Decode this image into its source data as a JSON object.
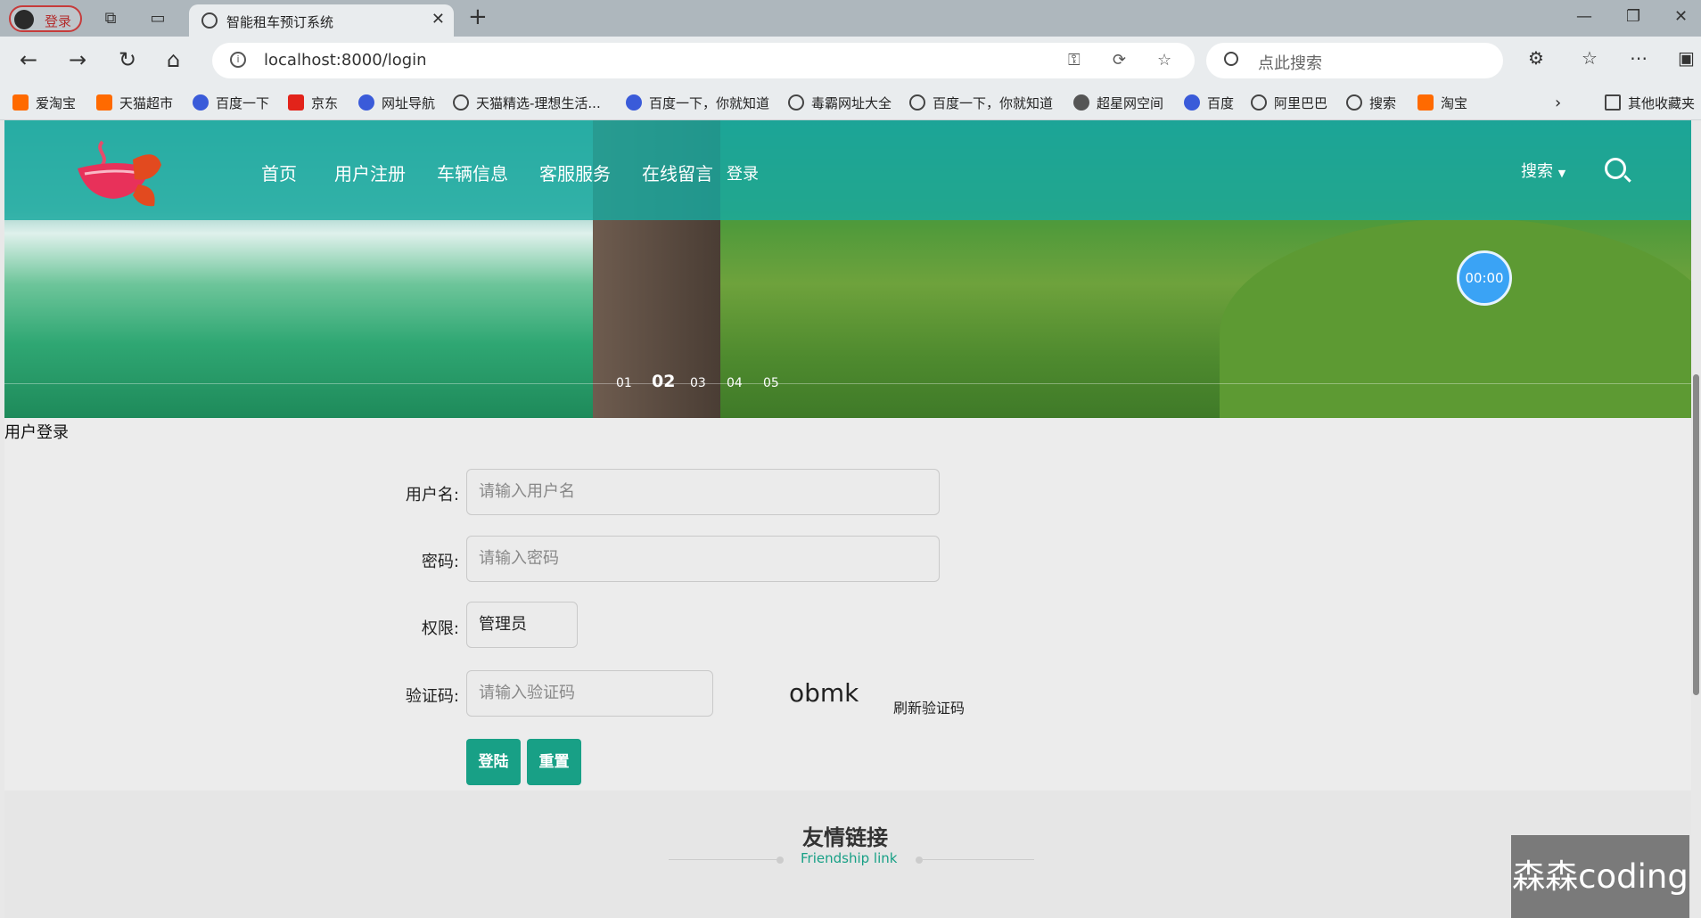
{
  "browser": {
    "profile_label": "登录",
    "tab_title": "智能租车预订系统",
    "url": "localhost:8000/login",
    "search_placeholder": "点此搜索",
    "bookmarks": [
      "爱淘宝",
      "天猫超市",
      "百度一下",
      "京东",
      "网址导航",
      "天猫精选-理想生活...",
      "百度一下，你就知道",
      "毒霸网址大全",
      "百度一下，你就知道",
      "超星网空间",
      "百度",
      "阿里巴巴",
      "搜索",
      "淘宝"
    ],
    "other_bookmarks": "其他收藏夹"
  },
  "site": {
    "nav": [
      "首页",
      "用户注册",
      "车辆信息",
      "客服服务",
      "在线留言",
      "登录"
    ],
    "search_label": "搜索",
    "timer": "00:00",
    "slides": [
      "01",
      "02",
      "03",
      "04",
      "05"
    ],
    "active_slide": "02"
  },
  "login": {
    "section_title": "用户登录",
    "username_label": "用户名:",
    "username_placeholder": "请输入用户名",
    "password_label": "密码:",
    "password_placeholder": "请输入密码",
    "role_label": "权限:",
    "role_value": "管理员",
    "captcha_label": "验证码:",
    "captcha_placeholder": "请输入验证码",
    "captcha_text": "obmk",
    "refresh_label": "刷新验证码",
    "login_button": "登陆",
    "reset_button": "重置"
  },
  "footer": {
    "title": "友情链接",
    "subtitle": "Friendship link"
  },
  "watermark": "森森coding"
}
